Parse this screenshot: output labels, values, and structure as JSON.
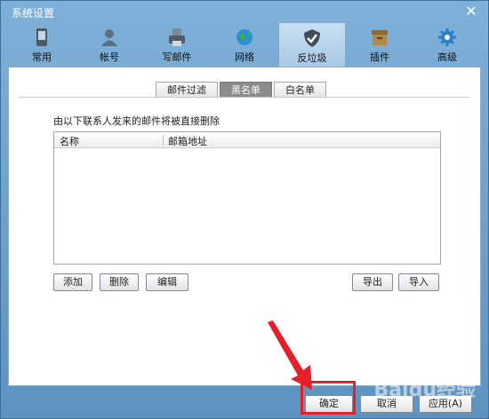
{
  "window": {
    "title": "系统设置"
  },
  "toolbar": {
    "items": [
      {
        "label": "常用",
        "icon": "phone-icon"
      },
      {
        "label": "帐号",
        "icon": "user-icon"
      },
      {
        "label": "写邮件",
        "icon": "printer-icon"
      },
      {
        "label": "网络",
        "icon": "globe-icon"
      },
      {
        "label": "反垃圾",
        "icon": "shield-icon",
        "active": true
      },
      {
        "label": "插件",
        "icon": "box-icon"
      },
      {
        "label": "高级",
        "icon": "gear-icon"
      }
    ]
  },
  "subtabs": [
    "邮件过滤",
    "黑名单",
    "白名单"
  ],
  "blacklist": {
    "description": "由以下联系人发来的邮件将被直接删除",
    "columns": [
      "名称",
      "邮箱地址"
    ],
    "rows": []
  },
  "list_buttons": {
    "add": "添加",
    "delete": "删除",
    "edit": "编辑",
    "export": "导出",
    "import": "导入"
  },
  "footer": {
    "ok": "确定",
    "cancel": "取消",
    "apply": "应用(A)"
  },
  "watermark": "Baidu经验",
  "colors": {
    "accent_highlight": "#e4202b",
    "active_subtab": "#8c8c8c"
  }
}
